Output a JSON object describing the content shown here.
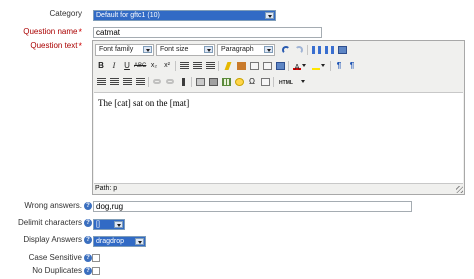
{
  "form": {
    "category": {
      "label": "Category",
      "value": "Default for gftc1 (10)"
    },
    "question_name": {
      "label": "Question name",
      "required_mark": "*",
      "value": "catmat"
    },
    "question_text": {
      "label": "Question text",
      "required_mark": "*"
    },
    "wrong_answers": {
      "label": "Wrong answers.",
      "value": "dog,rug"
    },
    "delimit_characters": {
      "label": "Delimit characters",
      "value": "[]"
    },
    "display_answers": {
      "label": "Display Answers",
      "value": "dragdrop"
    },
    "case_sensitive": {
      "label": "Case Sensitive",
      "checked": false
    },
    "no_duplicates": {
      "label": "No Duplicates",
      "checked": false
    }
  },
  "editor": {
    "font_family": "Font family",
    "font_size": "Font size",
    "format": "Paragraph",
    "content": "The [cat] sat on the [mat]",
    "path_label": "Path: p",
    "buttons": {
      "bold": "B",
      "italic": "I",
      "underline": "U",
      "strike": "ABC",
      "sub": "x₂",
      "sup": "x²",
      "html": "HTML",
      "omega": "Ω"
    }
  },
  "help_icon_glyph": "?",
  "colors": {
    "select_bg": "#316ac5",
    "required": "#aa0000",
    "help": "#3b6fbf"
  }
}
